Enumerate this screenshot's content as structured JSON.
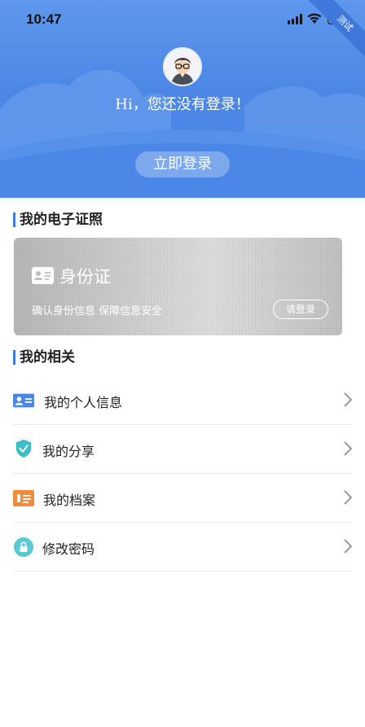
{
  "status_bar": {
    "time": "10:47"
  },
  "header": {
    "badge": "测试",
    "greeting": "Hi，您还没有登录！",
    "login_button": "立即登录"
  },
  "certificates": {
    "section_title": "我的电子证照",
    "id_card": {
      "title": "身份证",
      "subtitle": "确认身份信息 保障信息安全",
      "login_button": "请登录"
    }
  },
  "related": {
    "section_title": "我的相关",
    "items": [
      {
        "label": "我的个人信息",
        "icon": "id-card-icon"
      },
      {
        "label": "我的分享",
        "icon": "shield-check-icon"
      },
      {
        "label": "我的档案",
        "icon": "archive-icon"
      },
      {
        "label": "修改密码",
        "icon": "lock-icon"
      }
    ]
  },
  "colors": {
    "header_blue": "#4c87e6",
    "accent": "#3d7be0"
  }
}
